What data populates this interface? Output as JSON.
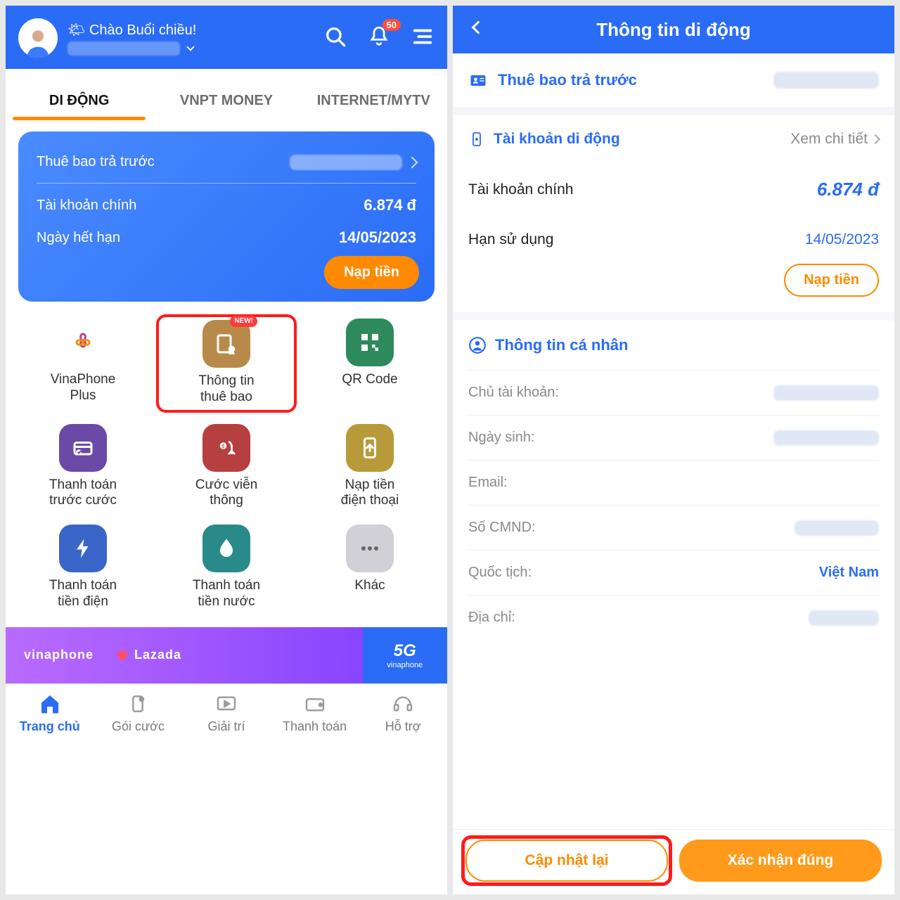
{
  "left": {
    "greeting_prefix": "Chào Buổi chiều!",
    "notif_count": "50",
    "tabs": [
      "DI ĐỘNG",
      "VNPT MONEY",
      "INTERNET/MYTV"
    ],
    "card": {
      "plan_label": "Thuê bao trả trước",
      "main_label": "Tài khoản chính",
      "main_value": "6.874 đ",
      "expiry_label": "Ngày hết hạn",
      "expiry_value": "14/05/2023",
      "topup": "Nạp tiền"
    },
    "grid": [
      {
        "label1": "VinaPhone",
        "label2": "Plus"
      },
      {
        "label1": "Thông tin",
        "label2": "thuê bao",
        "badge": "NEW!"
      },
      {
        "label1": "QR Code",
        "label2": ""
      },
      {
        "label1": "Thanh toán",
        "label2": "trước cước"
      },
      {
        "label1": "Cước viễn",
        "label2": "thông"
      },
      {
        "label1": "Nạp tiền",
        "label2": "điện thoại"
      },
      {
        "label1": "Thanh toán",
        "label2": "tiền điện"
      },
      {
        "label1": "Thanh toán",
        "label2": "tiền nước"
      },
      {
        "label1": "Khác",
        "label2": ""
      }
    ],
    "promo": {
      "brand1": "vinaphone",
      "brand2": "Lazada",
      "brand3": "5G",
      "brand3_sub": "vinaphone"
    },
    "nav": [
      "Trang chủ",
      "Gói cước",
      "Giải trí",
      "Thanh toán",
      "Hỗ trợ"
    ]
  },
  "right": {
    "title": "Thông tin di động",
    "plan_label": "Thuê bao trả trước",
    "account_section": {
      "head": "Tài khoản di động",
      "view_detail": "Xem chi tiết",
      "main_label": "Tài khoản chính",
      "main_value": "6.874 đ",
      "exp_label": "Hạn sử dụng",
      "exp_value": "14/05/2023",
      "topup": "Nạp tiền"
    },
    "personal_section": {
      "head": "Thông tin cá nhân",
      "rows": [
        "Chủ tài khoản:",
        "Ngày sinh:",
        "Email:",
        "Số CMND:",
        "Quốc tịch:",
        "Địa chỉ:"
      ],
      "nationality_value": "Việt Nam"
    },
    "buttons": {
      "update": "Cập nhật lại",
      "confirm": "Xác nhận đúng"
    }
  }
}
